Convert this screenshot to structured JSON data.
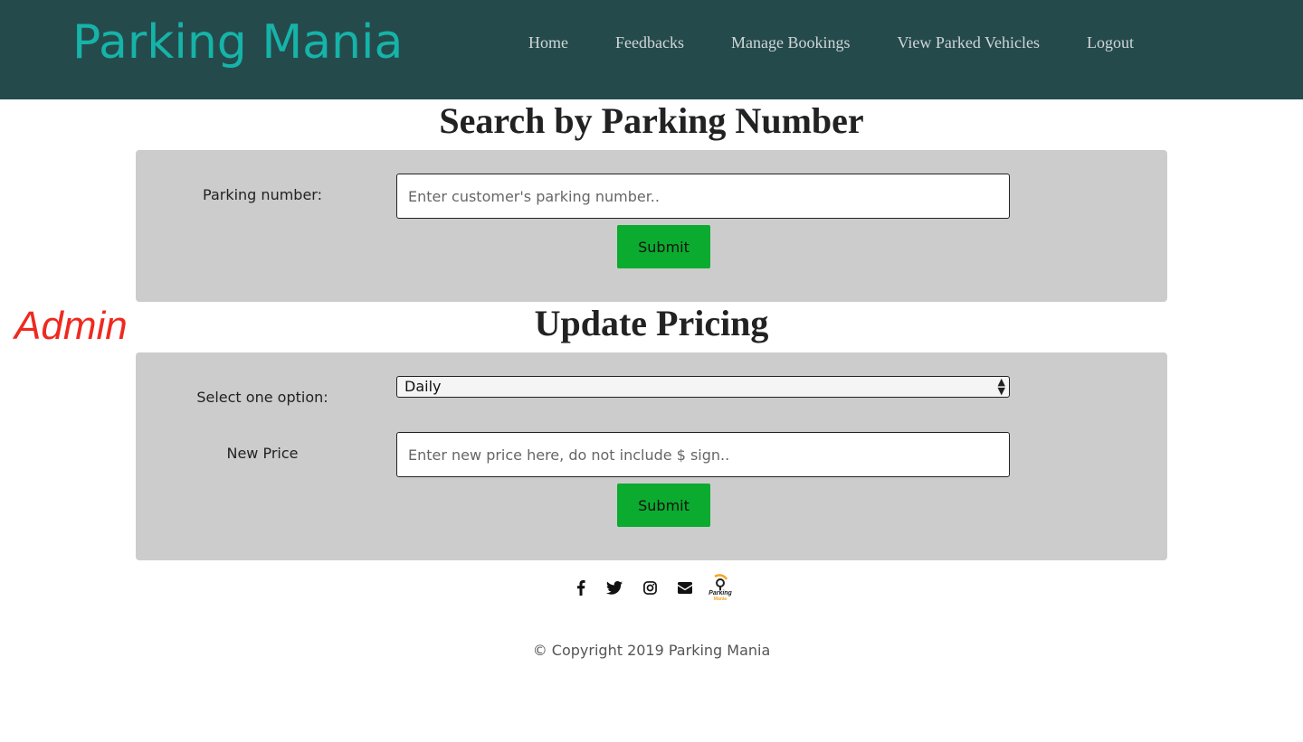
{
  "header": {
    "brand": "Parking Mania",
    "nav": {
      "home": "Home",
      "feedbacks": "Feedbacks",
      "manage_bookings": "Manage Bookings",
      "view_parked": "View Parked Vehicles",
      "logout": "Logout"
    },
    "colors": {
      "background": "#254a4c",
      "brand": "#16b3a8",
      "link": "#cfd6d6"
    }
  },
  "admin_label": "Admin",
  "search_section": {
    "title": "Search by Parking Number",
    "label": "Parking number:",
    "placeholder": "Enter customer's parking number..",
    "submit": "Submit"
  },
  "pricing_section": {
    "title": "Update Pricing",
    "select_label": "Select one option:",
    "selected_option": "Daily",
    "price_label": "New Price",
    "price_placeholder": "Enter new price here, do not include $ sign..",
    "submit": "Submit"
  },
  "footer": {
    "icons": [
      "facebook-icon",
      "twitter-icon",
      "instagram-icon",
      "envelope-icon",
      "parking-mania-logo"
    ],
    "logo_text": "Parking Mania",
    "copyright": "© Copyright 2019 Parking Mania"
  },
  "colors": {
    "submit": "#0aab2f",
    "panel": "#cccccc",
    "admin": "#ee2a1f"
  }
}
